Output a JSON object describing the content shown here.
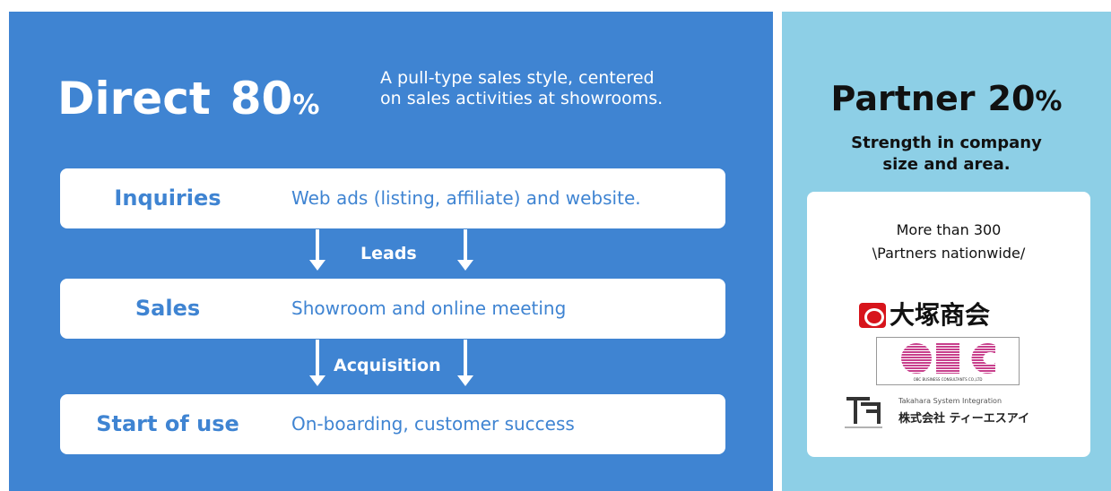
{
  "direct": {
    "label": "Direct",
    "percent": "80",
    "percent_sign": "%",
    "description_line1": "A pull-type sales style, centered",
    "description_line2": "on sales activities at showrooms.",
    "steps": [
      {
        "name": "Inquiries",
        "detail": "Web ads (listing, affiliate) and website."
      },
      {
        "name": "Sales",
        "detail": "Showroom and online meeting"
      },
      {
        "name": "Start of use",
        "detail": "On-boarding, customer success"
      }
    ],
    "flows": [
      "Leads",
      "Acquisition"
    ]
  },
  "partner": {
    "label": "Partner",
    "percent": "20",
    "percent_sign": "%",
    "description_line1": "Strength in company",
    "description_line2": "size and area.",
    "card": {
      "line1": "More than 300",
      "line2": "\\Partners nationwide/",
      "logos": {
        "otsuka": "大塚商会",
        "obc_caption": "OBC BUSINESS CONSULTANTS CO.,LTD",
        "tsi_en": "Takahara System Integration",
        "tsi_jp": "株式会社 ティーエスアイ"
      }
    }
  },
  "colors": {
    "direct_bg": "#3f84d2",
    "partner_bg": "#8dcfe6",
    "obc_pink": "#c83f8c"
  }
}
